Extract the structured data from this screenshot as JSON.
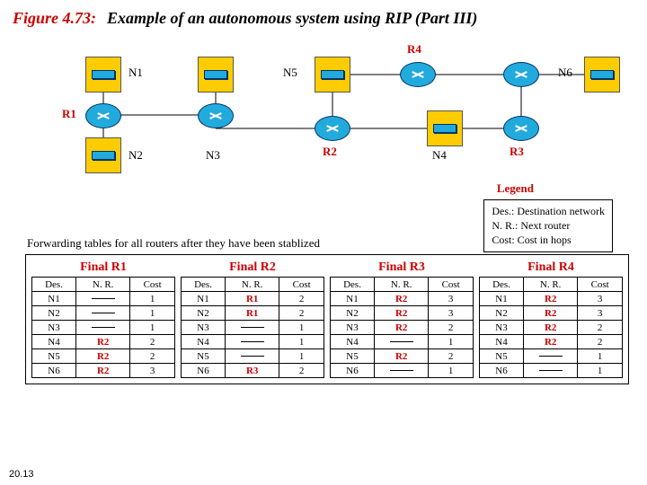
{
  "figure": {
    "prefix": "Figure 4.73:",
    "title": "Example of an autonomous system using RIP (Part III)"
  },
  "labels": {
    "N1": "N1",
    "N2": "N2",
    "N3": "N3",
    "N4": "N4",
    "N5": "N5",
    "N6": "N6",
    "R1": "R1",
    "R2": "R2",
    "R3": "R3",
    "R4": "R4"
  },
  "legend": {
    "title": "Legend",
    "l1": "Des.: Destination network",
    "l2": "N. R.: Next router",
    "l3": "Cost: Cost in hops"
  },
  "caption": "Forwarding tables for all routers after they have been stablized",
  "headers": {
    "des": "Des.",
    "nr": "N. R.",
    "cost": "Cost"
  },
  "tables": [
    {
      "name": "Final R1",
      "rows": [
        {
          "des": "N1",
          "nr": "",
          "cost": "1"
        },
        {
          "des": "N2",
          "nr": "",
          "cost": "1"
        },
        {
          "des": "N3",
          "nr": "",
          "cost": "1"
        },
        {
          "des": "N4",
          "nr": "R2",
          "cost": "2"
        },
        {
          "des": "N5",
          "nr": "R2",
          "cost": "2"
        },
        {
          "des": "N6",
          "nr": "R2",
          "cost": "3"
        }
      ]
    },
    {
      "name": "Final R2",
      "rows": [
        {
          "des": "N1",
          "nr": "R1",
          "cost": "2"
        },
        {
          "des": "N2",
          "nr": "R1",
          "cost": "2"
        },
        {
          "des": "N3",
          "nr": "",
          "cost": "1"
        },
        {
          "des": "N4",
          "nr": "",
          "cost": "1"
        },
        {
          "des": "N5",
          "nr": "",
          "cost": "1"
        },
        {
          "des": "N6",
          "nr": "R3",
          "cost": "2"
        }
      ]
    },
    {
      "name": "Final R3",
      "rows": [
        {
          "des": "N1",
          "nr": "R2",
          "cost": "3"
        },
        {
          "des": "N2",
          "nr": "R2",
          "cost": "3"
        },
        {
          "des": "N3",
          "nr": "R2",
          "cost": "2"
        },
        {
          "des": "N4",
          "nr": "",
          "cost": "1"
        },
        {
          "des": "N5",
          "nr": "R2",
          "cost": "2"
        },
        {
          "des": "N6",
          "nr": "",
          "cost": "1"
        }
      ]
    },
    {
      "name": "Final R4",
      "rows": [
        {
          "des": "N1",
          "nr": "R2",
          "cost": "3"
        },
        {
          "des": "N2",
          "nr": "R2",
          "cost": "3"
        },
        {
          "des": "N3",
          "nr": "R2",
          "cost": "2"
        },
        {
          "des": "N4",
          "nr": "R2",
          "cost": "2"
        },
        {
          "des": "N5",
          "nr": "",
          "cost": "1"
        },
        {
          "des": "N6",
          "nr": "",
          "cost": "1"
        }
      ]
    }
  ],
  "page": "20.13"
}
